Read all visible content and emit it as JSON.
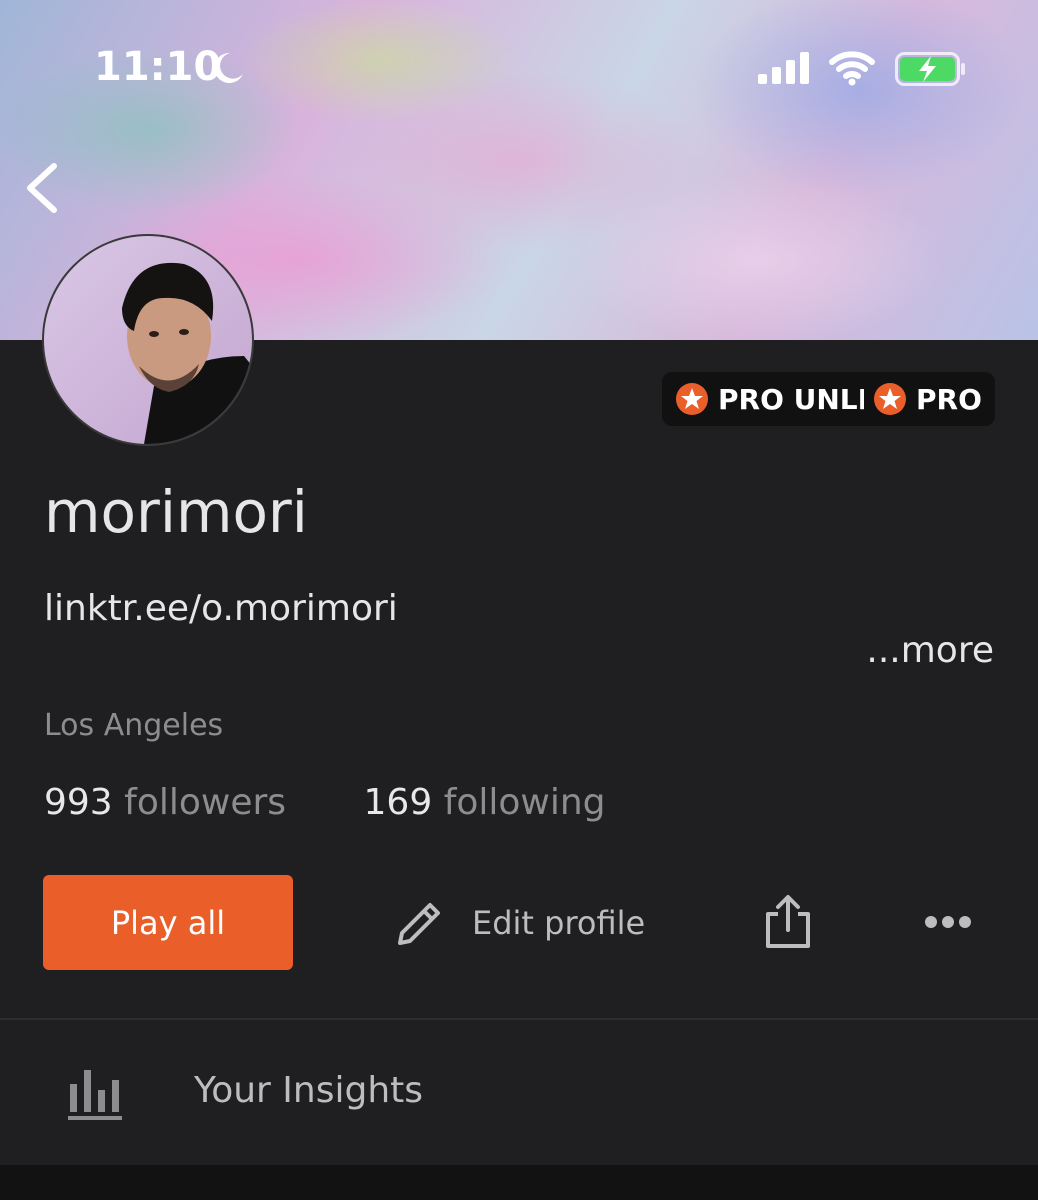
{
  "status_bar": {
    "time": "11:10"
  },
  "profile": {
    "username": "morimori",
    "bio_link": "linktr.ee/o.morimori",
    "more_label": "...more",
    "location": "Los Angeles",
    "badges": [
      "PRO UNLIMITED",
      "PRO"
    ],
    "followers": {
      "count": "993",
      "label": "followers"
    },
    "following": {
      "count": "169",
      "label": "following"
    }
  },
  "actions": {
    "play_all": "Play all",
    "edit_profile": "Edit profile"
  },
  "insights": {
    "label": "Your Insights"
  },
  "colors": {
    "accent": "#ea5e2a",
    "background": "#1f1e20",
    "badge_bg": "#111112"
  }
}
